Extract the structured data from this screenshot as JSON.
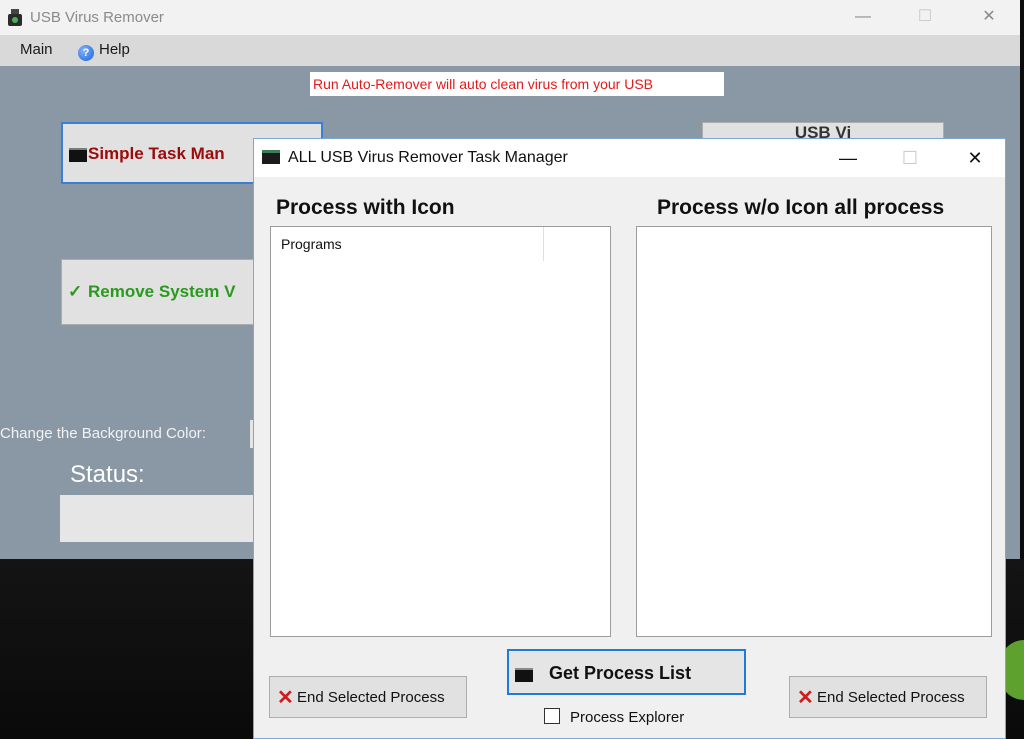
{
  "main_window": {
    "title": "USB Virus Remover",
    "controls": {
      "minimize": "—",
      "maximize": "☐",
      "close": "✕"
    },
    "menu": {
      "main": "Main",
      "help": "Help"
    },
    "autoremover_note": "Run Auto-Remover will auto clean virus from your USB",
    "simple_task_manager_btn": "Simple Task Man",
    "remove_system_btn": "Remove System V",
    "usb_btn": "USB Vi",
    "bg_color_label": "Change the Background Color:",
    "status_label": "Status:",
    "status_value": ""
  },
  "task_manager": {
    "title": "ALL USB Virus Remover Task Manager",
    "controls": {
      "minimize": "—",
      "maximize": "☐",
      "close": "✕"
    },
    "left_heading": "Process with Icon",
    "right_heading": "Process w/o Icon all process",
    "left_list_column": "Programs",
    "end_process_left": "End Selected Process",
    "end_process_right": "End Selected Process",
    "get_process_list": "Get Process List",
    "process_explorer_label": "Process Explorer",
    "process_explorer_checked": false
  },
  "colors": {
    "main_bg": "#8a98a6",
    "accent_blue": "#1f7ad8",
    "warning_red": "#e21b1b",
    "success_green": "#2a9a1f",
    "dark_red": "#9b0b0b"
  }
}
